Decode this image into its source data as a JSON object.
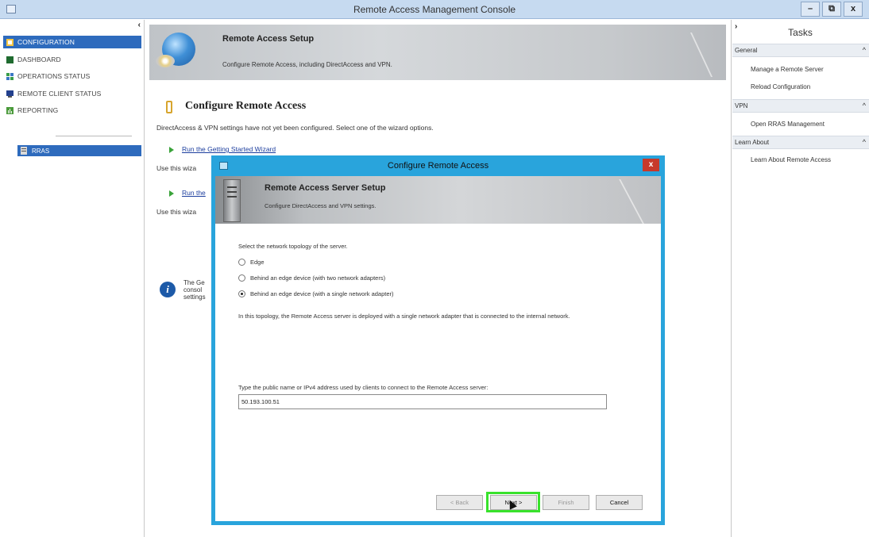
{
  "window": {
    "title": "Remote Access Management Console",
    "buttons": [
      "–",
      "⧉",
      "x"
    ]
  },
  "nav": {
    "collapse": "‹",
    "items": [
      {
        "label": "CONFIGURATION",
        "icon": "configuration-icon",
        "selected": true
      },
      {
        "label": "DASHBOARD",
        "icon": "dashboard-icon"
      },
      {
        "label": "OPERATIONS STATUS",
        "icon": "operations-status-icon"
      },
      {
        "label": "REMOTE CLIENT STATUS",
        "icon": "remote-client-status-icon"
      },
      {
        "label": "REPORTING",
        "icon": "reporting-icon"
      }
    ],
    "server": "RRAS"
  },
  "main": {
    "banner_title": "Remote Access Setup",
    "banner_subtitle": "Configure Remote Access, including DirectAccess and VPN.",
    "section_title": "Configure Remote Access",
    "description": "DirectAccess & VPN settings have not yet been configured. Select one of the wizard options.",
    "link1": "Run the Getting Started Wizard",
    "use1": "Use this wiza",
    "link2": "Run the",
    "use2": "Use this wiza",
    "info_text": [
      "The Ge",
      "consol",
      "settings"
    ]
  },
  "tasks": {
    "collapse": "›",
    "title": "Tasks",
    "sections": [
      {
        "label": "General",
        "items": [
          "Manage a Remote Server",
          "Reload Configuration"
        ]
      },
      {
        "label": "VPN",
        "items": [
          "Open RRAS Management"
        ]
      },
      {
        "label": "Learn About",
        "items": [
          "Learn About Remote Access"
        ]
      }
    ],
    "caret": "^"
  },
  "dialog": {
    "title": "Configure Remote Access",
    "close": "x",
    "banner_title": "Remote Access Server Setup",
    "banner_subtitle": "Configure DirectAccess and VPN settings.",
    "prompt": "Select the network topology of the server.",
    "options": [
      {
        "label": "Edge",
        "selected": false
      },
      {
        "label": "Behind an edge device (with two network adapters)",
        "selected": false
      },
      {
        "label": "Behind an edge device (with a single network adapter)",
        "selected": true
      }
    ],
    "topology_description": "In this topology, the Remote Access server is deployed with a single network adapter that is connected to the internal network.",
    "public_label": "Type the public name or IPv4 address used by clients to connect to the Remote Access server:",
    "public_value": "50.193.100.51",
    "buttons": {
      "back": "< Back",
      "next": "Next >",
      "finish": "Finish",
      "cancel": "Cancel"
    }
  }
}
